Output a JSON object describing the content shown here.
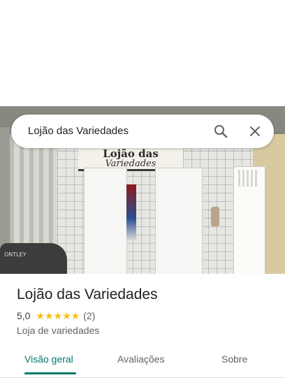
{
  "search": {
    "query": "Lojão das Variedades"
  },
  "hero": {
    "sign_line1": "Lojão das",
    "sign_line2": "Variedades"
  },
  "place": {
    "title": "Lojão das Variedades",
    "rating": "5,0",
    "stars": 5,
    "review_count": "(2)",
    "category": "Loja de variedades"
  },
  "tabs": [
    {
      "label": "Visão geral",
      "active": true
    },
    {
      "label": "Avaliações",
      "active": false
    },
    {
      "label": "Sobre",
      "active": false
    }
  ],
  "colors": {
    "accent": "#00796b",
    "star": "#fbbc04",
    "secondary_text": "#5f6368"
  },
  "icons": {
    "search": "search-icon",
    "close": "close-icon",
    "star": "star-icon"
  }
}
